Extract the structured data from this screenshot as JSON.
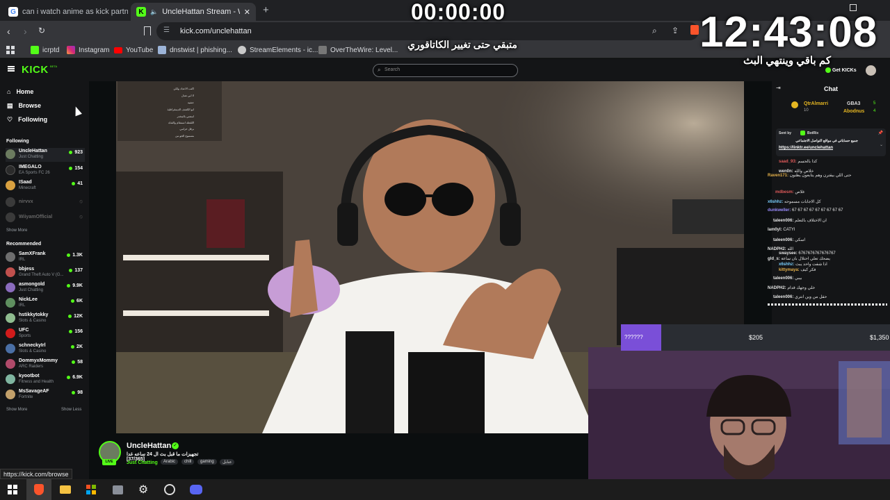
{
  "browser": {
    "tabs": [
      {
        "title": "can i watch anime as kick partner - G",
        "active": false
      },
      {
        "title": "UncleHattan Stream - Watch Li",
        "active": true
      }
    ],
    "new_tab": "+",
    "url": "kick.com/unclehattan",
    "bookmarks": [
      "icrptd",
      "Instagram",
      "YouTube",
      "dnstwist | phishing...",
      "StreamElements - ic...",
      "OverTheWire: Level..."
    ],
    "status_url": "https://kick.com/browse"
  },
  "overlay": {
    "countdown_top": "00:00:00",
    "clock": "12:43:08",
    "arabic_top": "متبقي حتى تغيير الكاتاقوري",
    "arabic_bottom": "كم باقي وينتهي البث"
  },
  "kick": {
    "logo": "KICK",
    "logo_badge": "BETA",
    "search_placeholder": "Search",
    "get_kicks": "Get KICKs",
    "nav": [
      {
        "label": "Home",
        "icon": "home-icon"
      },
      {
        "label": "Browse",
        "icon": "compass-icon"
      },
      {
        "label": "Following",
        "icon": "heart-icon"
      }
    ],
    "following_title": "Following",
    "following": [
      {
        "name": "UncleHattan",
        "category": "Just Chatting",
        "viewers": "923",
        "color": "#6b7b5f"
      },
      {
        "name": "IMEGALO",
        "category": "EA Sports FC 26",
        "viewers": "154",
        "color": "#2b2b2b"
      },
      {
        "name": "ISaad",
        "category": "Minecraft",
        "viewers": "41",
        "color": "#d8a040"
      }
    ],
    "offline": [
      "nirvvx",
      "WiiyamOfficial"
    ],
    "show_more_1": "Show More",
    "recommended_title": "Recommended",
    "recommended": [
      {
        "name": "SamXFrank",
        "category": "IRL",
        "viewers": "1.3K",
        "color": "#6e6e6e"
      },
      {
        "name": "bbjess",
        "category": "Grand Theft Auto V (G...",
        "viewers": "137",
        "color": "#c0504d"
      },
      {
        "name": "asmongold",
        "category": "Just Chatting",
        "viewers": "9.9K",
        "color": "#8a6bbd"
      },
      {
        "name": "NickLee",
        "category": "IRL",
        "viewers": "6K",
        "color": "#5f8f5f"
      },
      {
        "name": "hstikkytokky",
        "category": "Slots & Casino",
        "viewers": "12K",
        "color": "#8fbc8f"
      },
      {
        "name": "UFC",
        "category": "Sports",
        "viewers": "156",
        "color": "#d11b1b"
      },
      {
        "name": "schneckyIrl",
        "category": "Slots & Casino",
        "viewers": "2K",
        "color": "#4a6fa5"
      },
      {
        "name": "DommyxMommy",
        "category": "ARC Raiders",
        "viewers": "58",
        "color": "#b04a6a"
      },
      {
        "name": "kyootbot",
        "category": "Fitness and Health",
        "viewers": "6.9K",
        "color": "#7fb5a0"
      },
      {
        "name": "MsSavageAF",
        "category": "Fortnite",
        "viewers": "98",
        "color": "#c2a06a"
      }
    ],
    "show_more_2": "Show More",
    "show_less": "Show Less",
    "streamer": {
      "name": "UncleHattan",
      "title": "تجهيزات ما قبل بث ال 24 ساعه غدا [37/365]",
      "category": "Just Chatting",
      "tags": [
        "Arabic",
        "chill",
        "gaming",
        "عنابل"
      ],
      "live": "LIVE"
    },
    "chat": {
      "title": "Chat",
      "top_users": [
        {
          "name": "QtrAlmarri",
          "value": "10"
        },
        {
          "name": "GBA3",
          "value": "5"
        },
        {
          "name": "Abodnus",
          "value": "4"
        }
      ],
      "pinned_by_label": "Sent by",
      "pinned_by": "BotRix",
      "pinned_text": "جميع حساباتي في مواقع التواصل الاجتماعي",
      "pinned_link": "https://linktr.ee/unclehattan",
      "messages": [
        {
          "user": "saad_93:",
          "text": "كذا بالحسم",
          "color": "#e05a5a"
        },
        {
          "user": "wen0n:",
          "text": "خلاص والله",
          "color": "#e8e8e8"
        },
        {
          "user": "Raven171:",
          "text": "حتى اللي بيقترن وهم يتابعون يظنون",
          "color": "#e8b34a"
        },
        {
          "user": "mdbesm:",
          "text": "غلاص",
          "color": "#e05a5a"
        },
        {
          "user": "x6shhz:",
          "text": "كل الاجابات مسموحه",
          "color": "#7ad0ff"
        },
        {
          "user": "dunkweller:",
          "text": "67 67 67 67 67 67 67 67 67",
          "color": "#9b8cff"
        },
        {
          "user": "taleen006:",
          "text": "ان الاختلاف بالتعلم",
          "color": "#e8e8e8"
        },
        {
          "user": "lam0yl:",
          "text": "CATYl",
          "color": "#e8e8e8"
        },
        {
          "user": "taleen006:",
          "text": "اسكي",
          "color": "#e8e8e8"
        },
        {
          "user": "NADPH2:",
          "text": "الله",
          "color": "#e8e8e8"
        },
        {
          "user": "swaysee:",
          "text": "6767676767676767",
          "color": "#e8e8e8"
        },
        {
          "user": "gld_s:",
          "text": "يضحك تعلي احتلال بان ساعة",
          "color": "#e8e8e8"
        },
        {
          "user": "x6shhz:",
          "text": "اذا شفت واحد يبث",
          "color": "#7ad0ff"
        },
        {
          "user": "kittymaya:",
          "text": "فكر كيف",
          "color": "#e8b34a"
        },
        {
          "user": "taleen006:",
          "text": "بيبي",
          "color": "#e8e8e8"
        },
        {
          "user": "NADPH2:",
          "text": "خلي وجهك قدام",
          "color": "#e8e8e8"
        },
        {
          "user": "taleen006:",
          "text": "حقل من وين انتري",
          "color": "#e8e8e8"
        }
      ]
    }
  },
  "donation": {
    "label": "??????",
    "amount_1": "$205",
    "amount_2": "$1,350"
  },
  "top_chat_overlay": [
    "اكتب الاعداد ولكن",
    "لا ابي تعدل",
    "عشيه",
    "ابو الكشف الديمقراطية",
    "امنعني بالمخدر",
    "اللقطه انستقام والقناه",
    "برقل حرامي",
    "مسموع الجو من"
  ],
  "taskbar": [
    "windows-logo-icon",
    "brave-browser-icon",
    "file-explorer-icon",
    "microsoft-store-icon",
    "app-icon",
    "settings-icon",
    "obs-icon",
    "discord-icon"
  ],
  "colors": {
    "kick_green": "#53fc18",
    "bg": "#0b0e0f",
    "panel": "#141517"
  }
}
